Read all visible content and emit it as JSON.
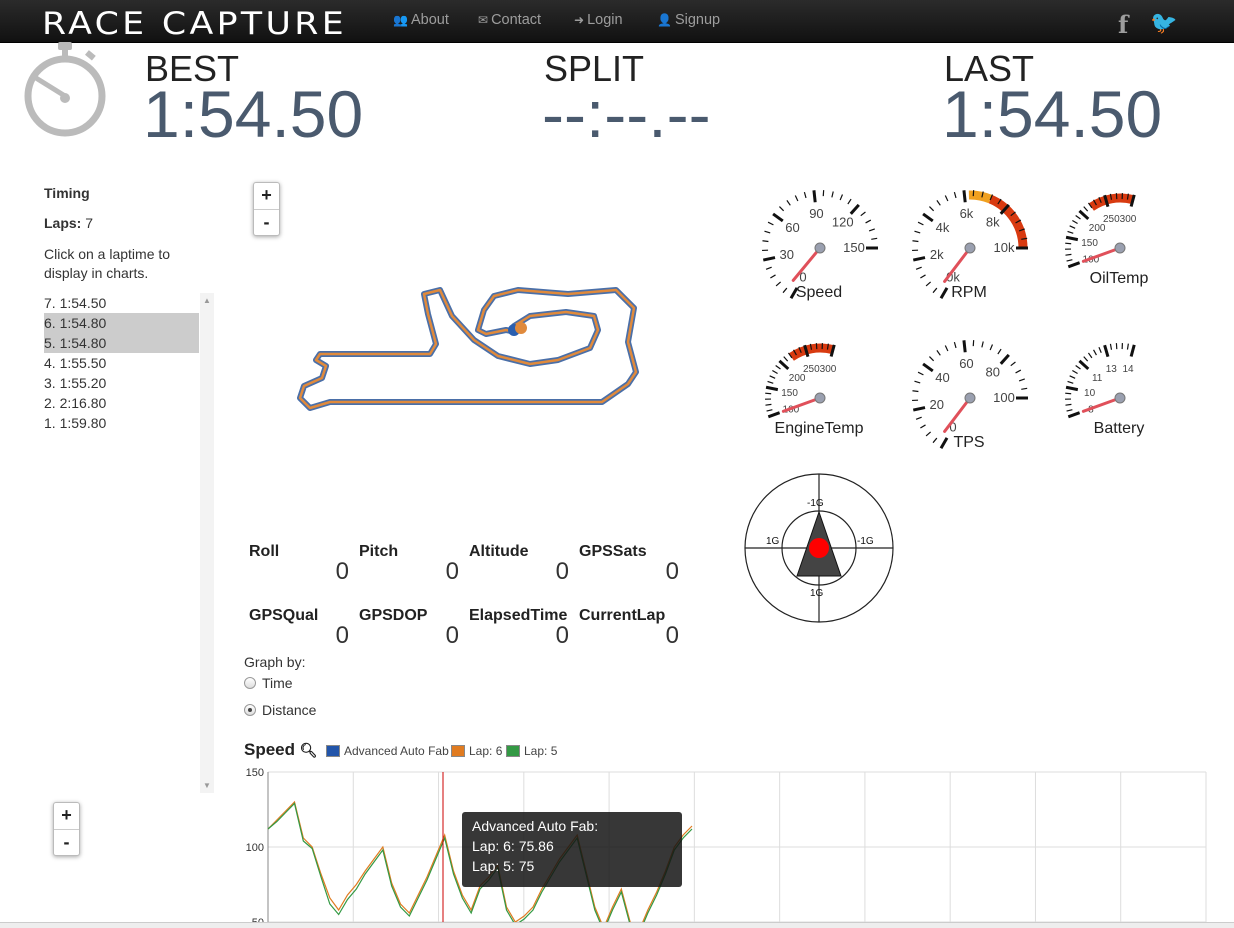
{
  "nav": {
    "brand": "RACE CAPTURE",
    "links": [
      {
        "label": "About",
        "icon": "users-icon",
        "glyph": "👥"
      },
      {
        "label": "Contact",
        "icon": "envelope-icon",
        "glyph": "✉"
      },
      {
        "label": "Login",
        "icon": "sign-in-icon",
        "glyph": "➜"
      },
      {
        "label": "Signup",
        "icon": "user-icon",
        "glyph": "👤"
      }
    ],
    "facebook": "f",
    "twitter": "🐦"
  },
  "laps_header": {
    "best_label": "BEST",
    "best_value": "1:54.50",
    "split_label": "SPLIT",
    "split_value": "--:--.--",
    "last_label": "LAST",
    "last_value": "1:54.50"
  },
  "timing": {
    "title": "Timing",
    "laps_label": "Laps:",
    "laps_count": "7",
    "hint": "Click on a laptime to display in charts.",
    "laps": [
      {
        "label": "7. 1:54.50",
        "selected": false
      },
      {
        "label": "6. 1:54.80",
        "selected": true
      },
      {
        "label": "5. 1:54.80",
        "selected": true
      },
      {
        "label": "4. 1:55.50",
        "selected": false
      },
      {
        "label": "3. 1:55.20",
        "selected": false
      },
      {
        "label": "2. 2:16.80",
        "selected": false
      },
      {
        "label": "1. 1:59.80",
        "selected": false
      }
    ]
  },
  "zoom": {
    "plus": "+",
    "minus": "-"
  },
  "gauges": [
    {
      "name": "Speed",
      "ticks": [
        "0",
        "30",
        "60",
        "90",
        "120",
        "150"
      ],
      "value_fraction": 0.04
    },
    {
      "name": "RPM",
      "ticks": [
        "0k",
        "2k",
        "4k",
        "6k",
        "8k",
        "10k"
      ],
      "value_fraction": 0.03
    },
    {
      "name": "OilTemp",
      "ticks": [
        "100",
        "150",
        "200",
        "250",
        "300"
      ],
      "value_fraction": 0.0
    },
    {
      "name": "EngineTemp",
      "ticks": [
        "100",
        "150",
        "200",
        "250",
        "300"
      ],
      "value_fraction": 0.0
    },
    {
      "name": "TPS",
      "ticks": [
        "0",
        "20",
        "40",
        "60",
        "80",
        "100"
      ],
      "value_fraction": 0.03
    },
    {
      "name": "Battery",
      "ticks": [
        "8",
        "10",
        "11",
        "13",
        "14"
      ],
      "value_fraction": 0.0
    }
  ],
  "gforce": {
    "top": "-1G",
    "bottom": "1G",
    "left": "1G",
    "right": "-1G"
  },
  "telemetry": [
    {
      "label": "Roll",
      "value": "0"
    },
    {
      "label": "Pitch",
      "value": "0"
    },
    {
      "label": "Altitude",
      "value": "0"
    },
    {
      "label": "GPSSats",
      "value": "0"
    },
    {
      "label": "GPSQual",
      "value": "0"
    },
    {
      "label": "GPSDOP",
      "value": "0"
    },
    {
      "label": "ElapsedTime",
      "value": "0"
    },
    {
      "label": "CurrentLap",
      "value": "0"
    }
  ],
  "graph_by": {
    "label": "Graph by:",
    "options": [
      {
        "label": "Time",
        "selected": false
      },
      {
        "label": "Distance",
        "selected": true
      }
    ]
  },
  "speed_chart": {
    "title": "Speed",
    "zoom_icon": "magnifier-icon",
    "legend": [
      {
        "label": "Advanced Auto Fab",
        "color": "#2255aa"
      },
      {
        "label": "Lap: 6",
        "color": "#e07b20"
      },
      {
        "label": "Lap: 5",
        "color": "#339944"
      }
    ],
    "tooltip": {
      "title": "Advanced Auto Fab:",
      "line1": "Lap: 6: 75.86",
      "line2": "Lap: 5: 75"
    }
  },
  "chart_data": {
    "type": "line",
    "title": "Speed",
    "y_ticks": [
      "150",
      "100",
      "50"
    ],
    "ylim": [
      50,
      150
    ],
    "grid": true,
    "series": [
      {
        "name": "Lap: 6",
        "color": "#e07b20",
        "values": [
          112,
          118,
          124,
          130,
          106,
          100,
          82,
          66,
          58,
          68,
          75,
          84,
          92,
          100,
          76,
          62,
          56,
          68,
          80,
          94,
          108,
          84,
          68,
          58,
          74,
          80,
          88,
          60,
          50,
          54,
          60,
          72,
          82,
          92,
          100,
          108,
          84,
          60,
          46,
          60,
          72,
          50,
          44,
          58,
          70,
          84,
          100,
          108,
          114
        ]
      },
      {
        "name": "Lap: 5",
        "color": "#339944",
        "values": [
          112,
          117,
          123,
          129,
          104,
          99,
          80,
          62,
          55,
          65,
          72,
          82,
          90,
          98,
          74,
          60,
          54,
          66,
          78,
          92,
          106,
          82,
          66,
          56,
          72,
          78,
          86,
          58,
          48,
          52,
          58,
          70,
          80,
          90,
          98,
          106,
          82,
          58,
          44,
          58,
          70,
          48,
          42,
          56,
          68,
          82,
          98,
          106,
          112
        ]
      }
    ]
  }
}
